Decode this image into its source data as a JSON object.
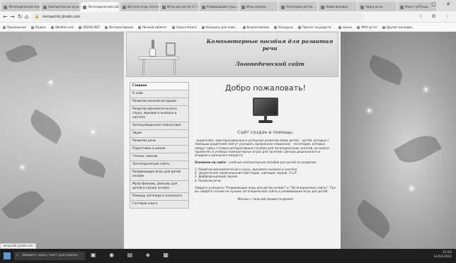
{
  "browser": {
    "tabs": [
      {
        "label": "Логопедические игры для детей..."
      },
      {
        "label": "Компьютерные игры для р..."
      },
      {
        "label": "Логопедический сайт...",
        "active": true
      },
      {
        "label": "Детские игры логопеда..."
      },
      {
        "label": "Игры для детей 3-7 лет"
      },
      {
        "label": "Развивающие игры..."
      },
      {
        "label": "Игры онлайн..."
      },
      {
        "label": "Логопедия детям..."
      },
      {
        "label": "Новая вкладка"
      },
      {
        "label": "Звуки речи..."
      },
      {
        "label": "Мульт-логопед..."
      }
    ],
    "url": "romaschki.jimdo.com",
    "bookmarks": [
      "Приложения",
      "Яндекс",
      "Weather.com",
      "DEHOU.NET",
      "Интерактивный",
      "Личный кабинет",
      "Серьги Книги",
      "Конкурсы для педа...",
      "Всероссийские",
      "Конкурсы",
      "Портал государств...",
      "жизнь",
      "MAX аутол",
      "Другие закладки"
    ]
  },
  "site": {
    "banner_title": "Компьютерные пособия для развития речи",
    "banner_subtitle": "Логопедический сайт",
    "menu": [
      "Главная",
      "О себе",
      "Развитие мелкой моторики",
      "Развитие фонематического слуха, звукового анализа и синтеза",
      "Артикуляционная гимнастика",
      "Звуки",
      "Развитие речи",
      "Подготовка к школе",
      "Чтение, письмо",
      "Логопедические сайты",
      "Развивающие игры для детей онлайн",
      "Мультфильмы, фильмы для детей и сказки онлайн",
      "Помощь логопеда и психолога",
      "Гостевая книга"
    ],
    "welcome": "Добро пожаловать!",
    "created_heading": "Сайт создан в помощь:",
    "help_lines": "- родителям, заинтересованным в успешном развитии своих детей; - детям, которые с помощью родителей смогут улучшить правильное говорение; - логопедам, которые найдут здесь готовые интерактивные пособия для логопедических занятий, их можно применять в учебных компьютерных играх для занятий с детьми дошкольного и младшего школьного возраста.",
    "main_intro_bold": "Основное на сайте",
    "main_intro_rest": " - учебные компьютерные пособия для детей по разделам:",
    "sections": [
      "1. Развитие фонематического слуха, звукового анализа и синтеза.",
      "2. Закрепление произношения свистящих, шипящих звуков, Л и Р.",
      "3. Дифференциация звуков.",
      "4. Развитие речи."
    ],
    "visit_text": "Зайдите в разделы \"Развивающие игры для детей онлайн\" и \"Логопедические сайты\". Там вы найдёте ссылки на лучшие логопедические сайты и развивающие игры для детей.",
    "wish": "Желаю с пользой провести время!"
  },
  "status_url": "romaschki.jimdo.com",
  "taskbar": {
    "search_placeholder": "Введите здесь текст для поиска",
    "time": "21:03",
    "date": "14.04.2021"
  }
}
